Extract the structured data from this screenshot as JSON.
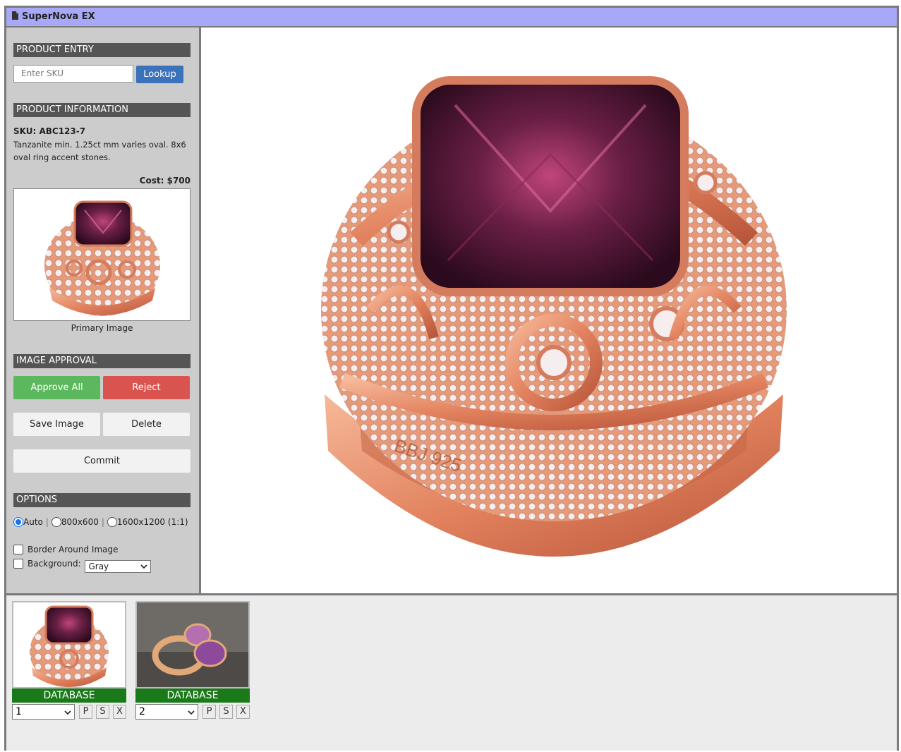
{
  "window": {
    "title": "SuperNova EX"
  },
  "sidebar": {
    "product_entry": {
      "heading": "PRODUCT ENTRY",
      "sku_placeholder": "Enter SKU",
      "lookup_label": "Lookup"
    },
    "product_info": {
      "heading": "PRODUCT INFORMATION",
      "sku_label": "SKU: ABC123-7",
      "description": "Tanzanite min. 1.25ct mm varies oval. 8x6 oval ring accent stones.",
      "cost_label": "Cost:",
      "cost_value": "$700",
      "image_caption": "Primary Image"
    },
    "approval": {
      "heading": "IMAGE APPROVAL",
      "approve_label": "Approve All",
      "reject_label": "Reject",
      "save_label": "Save Image",
      "delete_label": "Delete",
      "commit_label": "Commit"
    },
    "options": {
      "heading": "OPTIONS",
      "size_options": [
        "Auto",
        "800x600",
        "1600x1200 (1:1)"
      ],
      "selected_size": "Auto",
      "border_label": "Border Around Image",
      "border_checked": false,
      "background_label": "Background:",
      "background_checked": false,
      "background_value": "Gray"
    }
  },
  "thumbnails": [
    {
      "label": "DATABASE",
      "order": "1",
      "buttons": [
        "P",
        "S",
        "X"
      ]
    },
    {
      "label": "DATABASE",
      "order": "2",
      "buttons": [
        "P",
        "S",
        "X"
      ]
    }
  ],
  "main_image": {
    "engraving": "BBJ 925"
  },
  "colors": {
    "titlebar": "#a8a8f8",
    "section_header": "#555555",
    "lookup": "#3b72b9",
    "approve": "#5cb85c",
    "reject": "#d9534f",
    "thumb_label": "#1a7a1a",
    "rose_gold": "#e8906c",
    "gem": "#5a1e3a"
  }
}
